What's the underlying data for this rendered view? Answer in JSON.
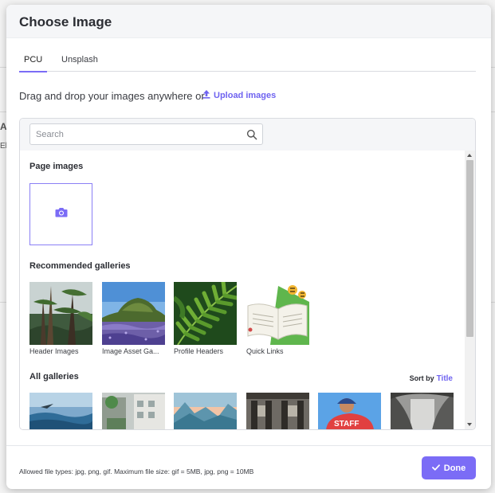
{
  "background_page": {
    "fragment_1": "A",
    "fragment_2": "El"
  },
  "modal": {
    "title": "Choose Image"
  },
  "tabs": [
    {
      "label": "PCU",
      "active": true
    },
    {
      "label": "Unsplash",
      "active": false
    }
  ],
  "upload": {
    "drag_text": "Drag and drop your images anywhere or",
    "upload_label": "Upload images",
    "icon": "upload-icon"
  },
  "search": {
    "placeholder": "Search",
    "value": "",
    "icon": "search-icon"
  },
  "sections": {
    "page_images": "Page images",
    "recommended": "Recommended galleries",
    "all": "All galleries"
  },
  "page_images": {
    "tile_icon": "camera-icon"
  },
  "recommended_galleries": [
    {
      "label": "Header Images",
      "thumb": "forest-trees"
    },
    {
      "label": "Image Asset Ga...",
      "thumb": "lupine-hill"
    },
    {
      "label": "Profile Headers",
      "thumb": "fern-leaves"
    },
    {
      "label": "Quick Links",
      "thumb": "open-book-illustration"
    }
  ],
  "all_galleries": [
    {
      "thumb": "ocean-bird"
    },
    {
      "thumb": "city-street"
    },
    {
      "thumb": "mountain-sunrise"
    },
    {
      "thumb": "old-building"
    },
    {
      "thumb": "staff-person"
    },
    {
      "thumb": "misty-trees"
    }
  ],
  "sort": {
    "label": "Sort by",
    "value": "Title"
  },
  "footer": {
    "allowed_text": "Allowed file types: jpg, png, gif. Maximum file size: gif = 5MB, jpg, png = 10MB",
    "done_label": "Done",
    "done_icon": "check-icon"
  },
  "colors": {
    "accent": "#7b6cf6",
    "link": "#6f63f0"
  }
}
